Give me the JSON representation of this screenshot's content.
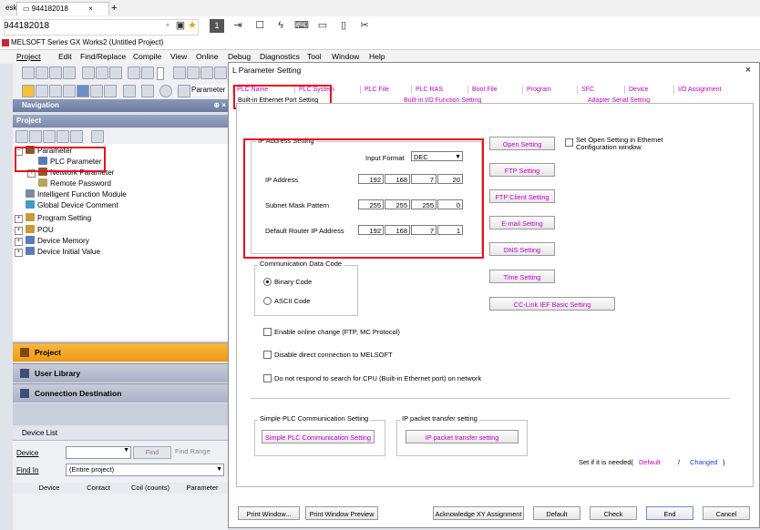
{
  "browser": {
    "tab_left": "esk",
    "tab_active": "944182018",
    "tab_close": "×",
    "tab_add": "+",
    "address": "944182018"
  },
  "app": {
    "title": "MELSOFT Series GX Works2 (Untitled Project)",
    "menu": [
      "Project",
      "Edit",
      "Find/Replace",
      "Compile",
      "View",
      "Online",
      "Debug",
      "Diagnostics",
      "Tool",
      "Window",
      "Help"
    ]
  },
  "toolbar": {
    "combo_label": "Parameter"
  },
  "navigation": {
    "header": "Navigation",
    "project_header": "Project",
    "pin": "⊕ ×",
    "tree": [
      {
        "label": "Parameter",
        "level": 0
      },
      {
        "label": "PLC Parameter",
        "level": 1
      },
      {
        "label": "Network Parameter",
        "level": 1
      },
      {
        "label": "Remote Password",
        "level": 1
      },
      {
        "label": "Intelligent Function Module",
        "level": 0
      },
      {
        "label": "Global Device Comment",
        "level": 0
      },
      {
        "label": "Program Setting",
        "level": 0
      },
      {
        "label": "POU",
        "level": 0
      },
      {
        "label": "Device Memory",
        "level": 0
      },
      {
        "label": "Device Initial Value",
        "level": 0
      }
    ],
    "panels": [
      "Project",
      "User Library",
      "Connection Destination"
    ]
  },
  "device_list": {
    "header": "Device List",
    "device_label": "Device",
    "find_button": "Find",
    "find_range_button": "Find Range",
    "find_in_label": "Find In",
    "find_in_value": "(Entire project)",
    "columns": [
      "Device",
      "Contact",
      "Coil (counts)",
      "Parameter"
    ]
  },
  "dialog": {
    "title": "L Parameter Setting",
    "close": "×",
    "tabs_row1": [
      "PLC Name",
      "PLC System",
      "PLC File",
      "PLC RAS",
      "Boot File",
      "Program",
      "SFC",
      "Device",
      "I/O Assignment"
    ],
    "tabs_row2": [
      "Built-in Ethernet Port Setting",
      "Built-in I/O Function Setting",
      "Adapter Serial Setting"
    ],
    "ip_group": {
      "title": "IP Address Setting",
      "input_format_label": "Input Format",
      "input_format_value": "DEC",
      "rows": [
        {
          "label": "IP Address",
          "values": [
            "192",
            "168",
            "7",
            "20"
          ]
        },
        {
          "label": "Subnet Mask Pattern",
          "values": [
            "255",
            "255",
            "255",
            "0"
          ]
        },
        {
          "label": "Default Router IP Address",
          "values": [
            "192",
            "168",
            "7",
            "1"
          ]
        }
      ]
    },
    "side_buttons": [
      "Open Setting",
      "FTP Setting",
      "FTP Client Setting",
      "E-mail Setting",
      "DNS Setting",
      "Time Setting",
      "CC-Link IEF Basic Setting"
    ],
    "open_setting_check": "Set Open Setting in Ethernet Configuration window",
    "comm_code": {
      "title": "Communication Data Code",
      "binary": "Binary Code",
      "ascii": "ASCII Code"
    },
    "checks": [
      "Enable online change (FTP, MC Protocol)",
      "Disable direct connection to MELSOFT",
      "Do not respond to search for CPU (Built-in Ethernet port) on network"
    ],
    "simple_plc": {
      "title": "Simple PLC Communication Setting",
      "button": "Simple PLC Communication Setting"
    },
    "ip_packet": {
      "title": "IP packet transfer setting",
      "button": "IP packet transfer setting"
    },
    "set_if_needed": {
      "label": "Set if it is needed(",
      "default": "Default",
      "slash": "/",
      "changed": "Changed",
      "close": ")"
    },
    "bottom_buttons": [
      "Print Window...",
      "Print Window Preview",
      "Acknowledge XY Assignment",
      "Default",
      "Check",
      "End",
      "Cancel"
    ]
  },
  "colors": {
    "magenta": "#c000c0",
    "highlight_red": "#e8101e",
    "nav_orange": "#f3a11a"
  }
}
